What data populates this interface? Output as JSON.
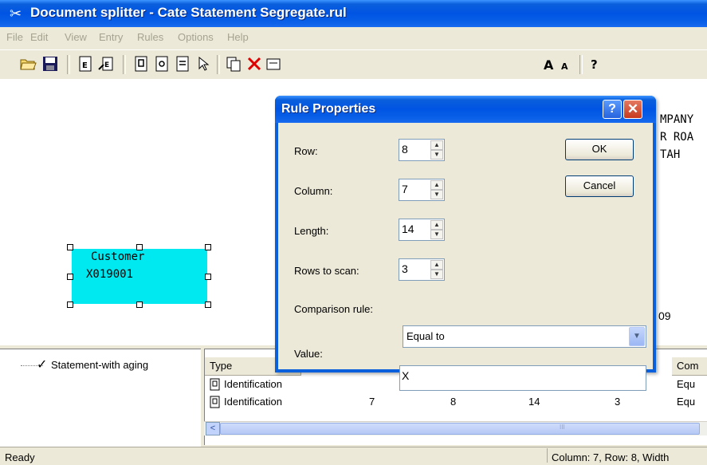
{
  "window": {
    "title": "Document splitter - Cate Statement Segregate.rul",
    "app_icon": "splitter-icon"
  },
  "menu": [
    "File",
    "Edit",
    "View",
    "Entry",
    "Rules",
    "Options",
    "Help"
  ],
  "document": {
    "right_text_lines": [
      "MPANY",
      "R ROA",
      "TAH"
    ],
    "bottom_right_text": "09",
    "rule_box_lines": [
      "Customer",
      "X019001"
    ]
  },
  "tree": {
    "check": "✓",
    "item": "Statement-with aging"
  },
  "list": {
    "headers": {
      "type": "Type",
      "last": "Com"
    },
    "rows": [
      {
        "type": "Identification",
        "col2": "",
        "col3": "",
        "col4": "",
        "col5": "",
        "last": "Equ"
      },
      {
        "type": "Identification",
        "col2": "7",
        "col3": "8",
        "col4": "14",
        "col5": "3",
        "last": "Equ"
      }
    ],
    "scroll_left": "<",
    "scroll_grip": "III"
  },
  "status": {
    "left": "Ready",
    "right": "Column: 7, Row: 8, Width"
  },
  "dialog": {
    "title": "Rule Properties",
    "help": "?",
    "close": "✕",
    "fields": {
      "row": {
        "label": "Row:",
        "value": "8"
      },
      "column": {
        "label": "Column:",
        "value": "7"
      },
      "length": {
        "label": "Length:",
        "value": "14"
      },
      "rows_to_scan": {
        "label": "Rows to scan:",
        "value": "3"
      },
      "comparison": {
        "label": "Comparison rule:",
        "value": "Equal to"
      },
      "value": {
        "label": "Value:",
        "value": "X"
      }
    },
    "ok_label": "OK",
    "cancel_label": "Cancel"
  },
  "colors": {
    "titlebar": "#0054e3",
    "rule_box": "#00e8f0",
    "window_face": "#ece9d8"
  }
}
